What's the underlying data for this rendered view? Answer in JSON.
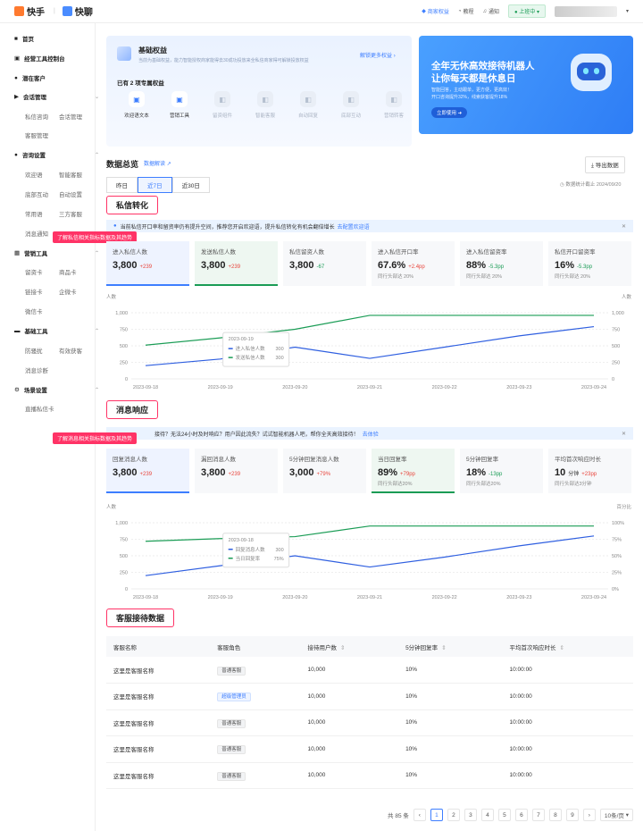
{
  "topbar": {
    "app1": "快手",
    "app2": "快聊",
    "links": [
      "商家权益",
      "教程",
      "通知"
    ],
    "online": "上班中"
  },
  "sidebar": {
    "items": [
      {
        "label": "首页",
        "icon": "home-icon"
      },
      {
        "label": "经营工具控制台",
        "icon": "console-icon"
      },
      {
        "label": "潜在客户",
        "icon": "user-icon"
      },
      {
        "label": "会话管理",
        "icon": "chat-icon",
        "sub": [
          [
            "私信咨询",
            "会话管理"
          ],
          [
            "客服管理"
          ]
        ]
      },
      {
        "label": "咨询设置",
        "icon": "user-icon",
        "sub": [
          [
            "欢迎语",
            "智能客服"
          ],
          [
            "底部互动",
            "自动设置"
          ],
          [
            "常用语",
            "三方客服"
          ],
          [
            "消息通知"
          ]
        ]
      },
      {
        "label": "营销工具",
        "icon": "tool-icon",
        "sub": [
          [
            "留资卡",
            "商品卡"
          ],
          [
            "链接卡",
            "企微卡"
          ],
          [
            "微信卡"
          ]
        ]
      },
      {
        "label": "基础工具",
        "icon": "box-icon",
        "sub": [
          [
            "防骚扰",
            "有效获客"
          ],
          [
            "消息诊断"
          ]
        ]
      },
      {
        "label": "场景设置",
        "icon": "gear-icon",
        "sub": [
          [
            "直播私信卡"
          ]
        ]
      }
    ]
  },
  "rights": {
    "title": "基础权益",
    "desc": "当前为基础权益，能力智能授权商家能得去30成功投放来全私信商家得可解锁投放权益",
    "link": "解锁更多权益",
    "owned": "已有 2 项专属权益",
    "items": [
      "欢迎语文本",
      "营销工具",
      "留资组件",
      "智能客服",
      "自动回复",
      "底部互动",
      "营销转客"
    ]
  },
  "banner": {
    "line1": "全年无休高效接待机器人",
    "line2": "让你每天都是休息日",
    "desc1": "智能回答，主动跟单，更方便，更高效！",
    "desc2": "开口咨询提升32%，线索获客提升18%",
    "btn": "立即使用"
  },
  "overview": {
    "title": "数据总览",
    "link": "数据解读",
    "export": "导出数据",
    "tabs": [
      "昨日",
      "近7日",
      "近30日"
    ],
    "date": "数据统计截止 2024/09/20"
  },
  "dm": {
    "title": "私信转化",
    "tip": "了解私信相关指标数据及其趋势",
    "info": "当前私信开口率和留资率仍有提升空间，推荐您开启欢迎语，提升私信转化有机会翻倍增长",
    "info_link": "去配置欢迎语",
    "metrics": [
      {
        "label": "进入私信人数",
        "value": "3,800",
        "delta": "+239",
        "dir": "up",
        "sub": ""
      },
      {
        "label": "发送私信人数",
        "value": "3,800",
        "delta": "+239",
        "dir": "up",
        "sub": ""
      },
      {
        "label": "私信留资人数",
        "value": "3,800",
        "delta": "-67",
        "dir": "dn",
        "sub": ""
      },
      {
        "label": "进入私信开口率",
        "value": "67.6%",
        "delta": "+2.4pp",
        "dir": "up",
        "sub": "同行头部达 20%"
      },
      {
        "label": "进入私信留资率",
        "value": "88%",
        "delta": "-5.3pp",
        "dir": "dn",
        "sub": "同行头部达 20%"
      },
      {
        "label": "私信开口留资率",
        "value": "16%",
        "delta": "-5.3pp",
        "dir": "dn",
        "sub": "同行头部达 20%"
      }
    ]
  },
  "chart_data": [
    {
      "type": "line",
      "ylabel": "人数",
      "ylabel_right": "人数",
      "ylim": [
        0,
        1000
      ],
      "yticks": [
        "0",
        "250",
        "500",
        "750",
        "1,000"
      ],
      "yticks_right": [
        "0",
        "250",
        "500",
        "750",
        "1,000"
      ],
      "x": [
        "2023-09-18",
        "2023-09-19",
        "2023-09-20",
        "2023-09-21",
        "2023-09-22",
        "2023-09-23",
        "2023-09-24"
      ],
      "series": [
        {
          "name": "进入私信人数",
          "color": "#2f5fe0",
          "values": [
            200,
            300,
            480,
            310,
            480,
            650,
            790
          ]
        },
        {
          "name": "发送私信人数",
          "color": "#1a9c55",
          "values": [
            510,
            620,
            750,
            960,
            960,
            960,
            960
          ]
        }
      ],
      "tooltip": {
        "date": "2023-09-19",
        "rows": [
          [
            "进入私信人数",
            "300"
          ],
          [
            "发送私信人数",
            "300"
          ]
        ]
      }
    },
    {
      "type": "line",
      "ylabel": "人数",
      "ylabel_right": "百分比",
      "ylim": [
        0,
        1000
      ],
      "yticks": [
        "0",
        "250",
        "500",
        "750",
        "1,000"
      ],
      "yticks_right": [
        "0%",
        "25%",
        "50%",
        "75%",
        "100%"
      ],
      "x": [
        "2023-09-18",
        "2023-09-19",
        "2023-09-20",
        "2023-09-21",
        "2023-09-22",
        "2023-09-23",
        "2023-09-24"
      ],
      "series": [
        {
          "name": "回复消息人数",
          "color": "#2f5fe0",
          "values": [
            200,
            350,
            500,
            330,
            480,
            650,
            800
          ]
        },
        {
          "name": "当日回复率",
          "color": "#1a9c55",
          "values": [
            720,
            760,
            790,
            950,
            950,
            950,
            950
          ]
        }
      ],
      "tooltip": {
        "date": "2023-09-18",
        "rows": [
          [
            "回复消息人数",
            "300"
          ],
          [
            "当日回复率",
            "75%"
          ]
        ]
      }
    }
  ],
  "resp": {
    "title": "消息响应",
    "tip": "了解消息相关指标数据及其趋势",
    "info": "接待？无法24小时及时响应？用户因此流失？试试智能机器人吧，帮你全天高效接待！",
    "info_link": "去体验",
    "metrics": [
      {
        "label": "回复消息人数",
        "value": "3,800",
        "delta": "+239",
        "dir": "up",
        "sub": ""
      },
      {
        "label": "漏回消息人数",
        "value": "3,800",
        "delta": "+239",
        "dir": "up",
        "sub": ""
      },
      {
        "label": "5分钟回复消息人数",
        "value": "3,000",
        "delta": "+79%",
        "dir": "up",
        "sub": ""
      },
      {
        "label": "当日回复率",
        "value": "89%",
        "delta": "+79pp",
        "dir": "up",
        "sub": "同行头部达20%"
      },
      {
        "label": "5分钟回复率",
        "value": "18%",
        "delta": "-13pp",
        "dir": "dn",
        "sub": "同行头部达20%"
      },
      {
        "label": "平均首次响应时长",
        "value": "10",
        "unit": "分钟",
        "delta": "+23pp",
        "dir": "up",
        "sub": "同行头部达3分钟"
      }
    ]
  },
  "service": {
    "title": "客服接待数据",
    "headers": [
      "客服名称",
      "客服角色",
      "接待用户数",
      "5分钟回复率",
      "平均首次响应时长"
    ],
    "rows": [
      [
        "这里是客服名称",
        "普通客服",
        "10,000",
        "10%",
        "10:00:00"
      ],
      [
        "这里是客服名称",
        "超级管理员",
        "10,000",
        "10%",
        "10:00:00"
      ],
      [
        "这里是客服名称",
        "普通客服",
        "10,000",
        "10%",
        "10:00:00"
      ],
      [
        "这里是客服名称",
        "普通客服",
        "10,000",
        "10%",
        "10:00:00"
      ],
      [
        "这里是客服名称",
        "普通客服",
        "10,000",
        "10%",
        "10:00:00"
      ]
    ]
  },
  "pager": {
    "total": "共 85 条",
    "pages": [
      "1",
      "2",
      "3",
      "4",
      "5",
      "6",
      "7",
      "8",
      "9"
    ],
    "size": "10条/页"
  }
}
